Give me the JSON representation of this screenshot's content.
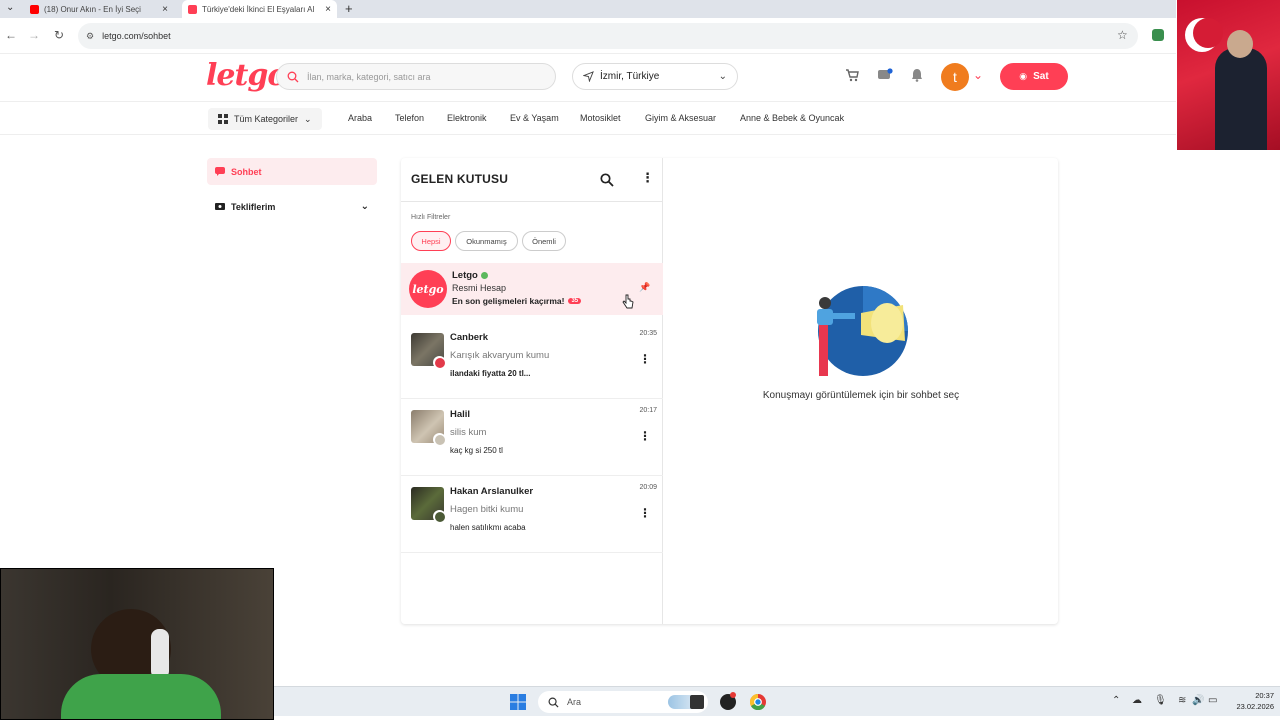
{
  "browser": {
    "tabs": [
      {
        "title": "(18) Onur Akın - En İyi Seçi",
        "active": false
      },
      {
        "title": "Türkiye'deki İkinci El Eşyaları Al",
        "active": true
      }
    ],
    "url": "letgo.com/sohbet"
  },
  "header": {
    "logo": "letgo",
    "search_placeholder": "İlan, marka, kategori, satıcı ara",
    "location": "İzmir, Türkiye",
    "user_initial": "t",
    "sell_label": "Sat"
  },
  "categories": {
    "all_label": "Tüm Kategoriler",
    "items": [
      "Araba",
      "Telefon",
      "Elektronik",
      "Ev & Yaşam",
      "Motosiklet",
      "Giyim & Aksesuar",
      "Anne & Bebek & Oyuncak"
    ]
  },
  "sidebar": {
    "chat_label": "Sohbet",
    "offers_label": "Tekliflerim"
  },
  "inbox": {
    "title": "GELEN KUTUSU",
    "filters_label": "Hızlı Filtreler",
    "filters": [
      "Hepsi",
      "Okunmamış",
      "Önemli"
    ],
    "official": {
      "name": "Letgo",
      "subtitle": "Resmi Hesap",
      "message": "En son gelişmeleri kaçırma!",
      "badge": "35",
      "avatar_text": "letgo"
    },
    "conversations": [
      {
        "name": "Canberk",
        "title": "Karışık akvaryum kumu",
        "message": "ilandaki fiyatta 20 tl...",
        "time": "20:35",
        "unread": true
      },
      {
        "name": "Halil",
        "title": "silis kum",
        "message": "kaç kg si 250 tl",
        "time": "20:17",
        "unread": false
      },
      {
        "name": "Hakan Arslanulker",
        "title": "Hagen bitki kumu",
        "message": "halen satılıkmı acaba",
        "time": "20:09",
        "unread": false
      }
    ]
  },
  "empty_state": {
    "text": "Konuşmayı görüntülemek için bir sohbet seç"
  },
  "taskbar": {
    "search_label": "Ara",
    "time": "20:37",
    "date": "23.02.2026"
  },
  "colors": {
    "brand": "#ff3f55",
    "brand_light": "#fdecee"
  }
}
